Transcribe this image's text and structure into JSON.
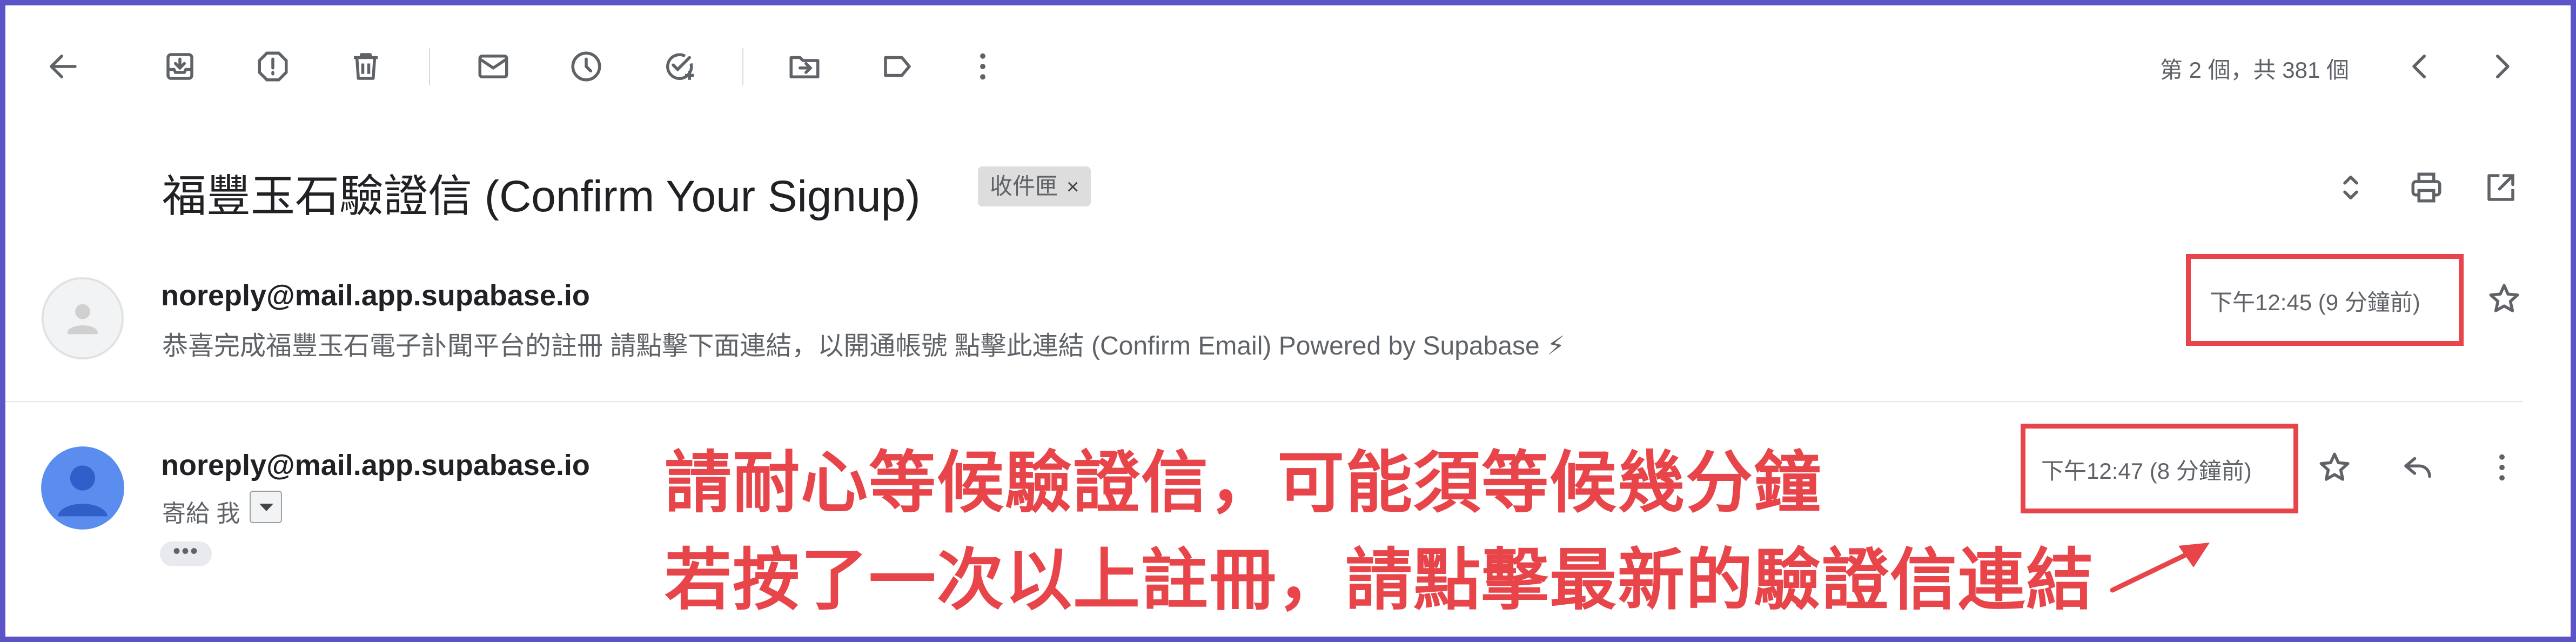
{
  "pager": {
    "text": "第 2 個，共 381 個"
  },
  "subject": {
    "title": "福豐玉石驗證信 (Confirm Your Signup)",
    "label": "收件匣",
    "label_close": "×"
  },
  "messages": [
    {
      "sender": "noreply@mail.app.supabase.io",
      "snippet": "恭喜完成福豐玉石電子訃聞平台的註冊 請點擊下面連結，以開通帳號 點擊此連結 (Confirm Email) Powered by Supabase ⚡",
      "time": "下午12:45 (9 分鐘前)"
    },
    {
      "sender": "noreply@mail.app.supabase.io",
      "to_line": "寄給 我",
      "time": "下午12:47 (8 分鐘前)",
      "ellipsis": "•••"
    }
  ],
  "annotation": {
    "line1": "請耐心等候驗證信，可能須等候幾分鐘",
    "line2": "若按了一次以上註冊，請點擊最新的驗證信連結"
  },
  "colors": {
    "annotation_red": "#e8454b",
    "frame_border": "#5a54c7",
    "avatar_blue": "#5b8def"
  },
  "toolbar_icons": [
    "back-arrow-icon",
    "archive-icon",
    "report-spam-icon",
    "delete-icon",
    "mark-unread-icon",
    "snooze-icon",
    "add-to-tasks-icon",
    "move-to-icon",
    "label-icon",
    "more-vert-icon"
  ]
}
